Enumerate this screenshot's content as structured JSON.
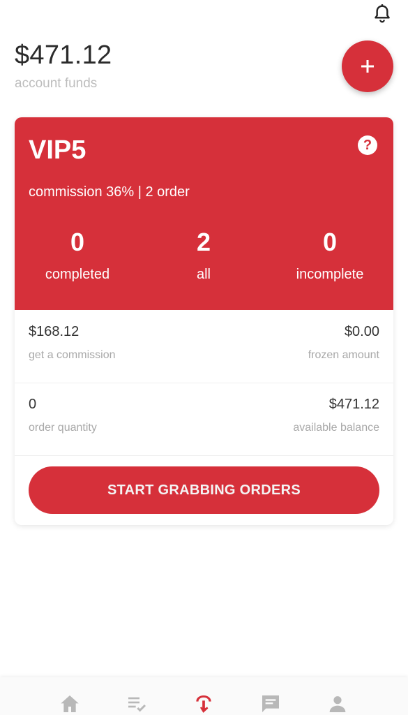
{
  "header": {
    "balance": "$471.12",
    "balance_label": "account funds"
  },
  "vip": {
    "level": "VIP5",
    "help": "?",
    "subtitle": "commission 36% | 2 order",
    "stats": [
      {
        "value": "0",
        "label": "completed"
      },
      {
        "value": "2",
        "label": "all"
      },
      {
        "value": "0",
        "label": "incomplete"
      }
    ]
  },
  "details": {
    "commission_value": "$168.12",
    "commission_label": "get a commission",
    "frozen_value": "$0.00",
    "frozen_label": "frozen amount",
    "order_qty_value": "0",
    "order_qty_label": "order quantity",
    "available_value": "$471.12",
    "available_label": "available balance"
  },
  "cta": {
    "label": "START GRABBING ORDERS"
  },
  "colors": {
    "accent": "#d6303a",
    "muted_text": "#a8a8a8",
    "inactive_icon": "#b8b8b8"
  },
  "icons": {
    "top": "bell-icon",
    "fab": "plus-icon",
    "tabs": [
      "home-icon",
      "playlist-check-icon",
      "grab-order-icon",
      "message-icon",
      "person-icon"
    ]
  }
}
